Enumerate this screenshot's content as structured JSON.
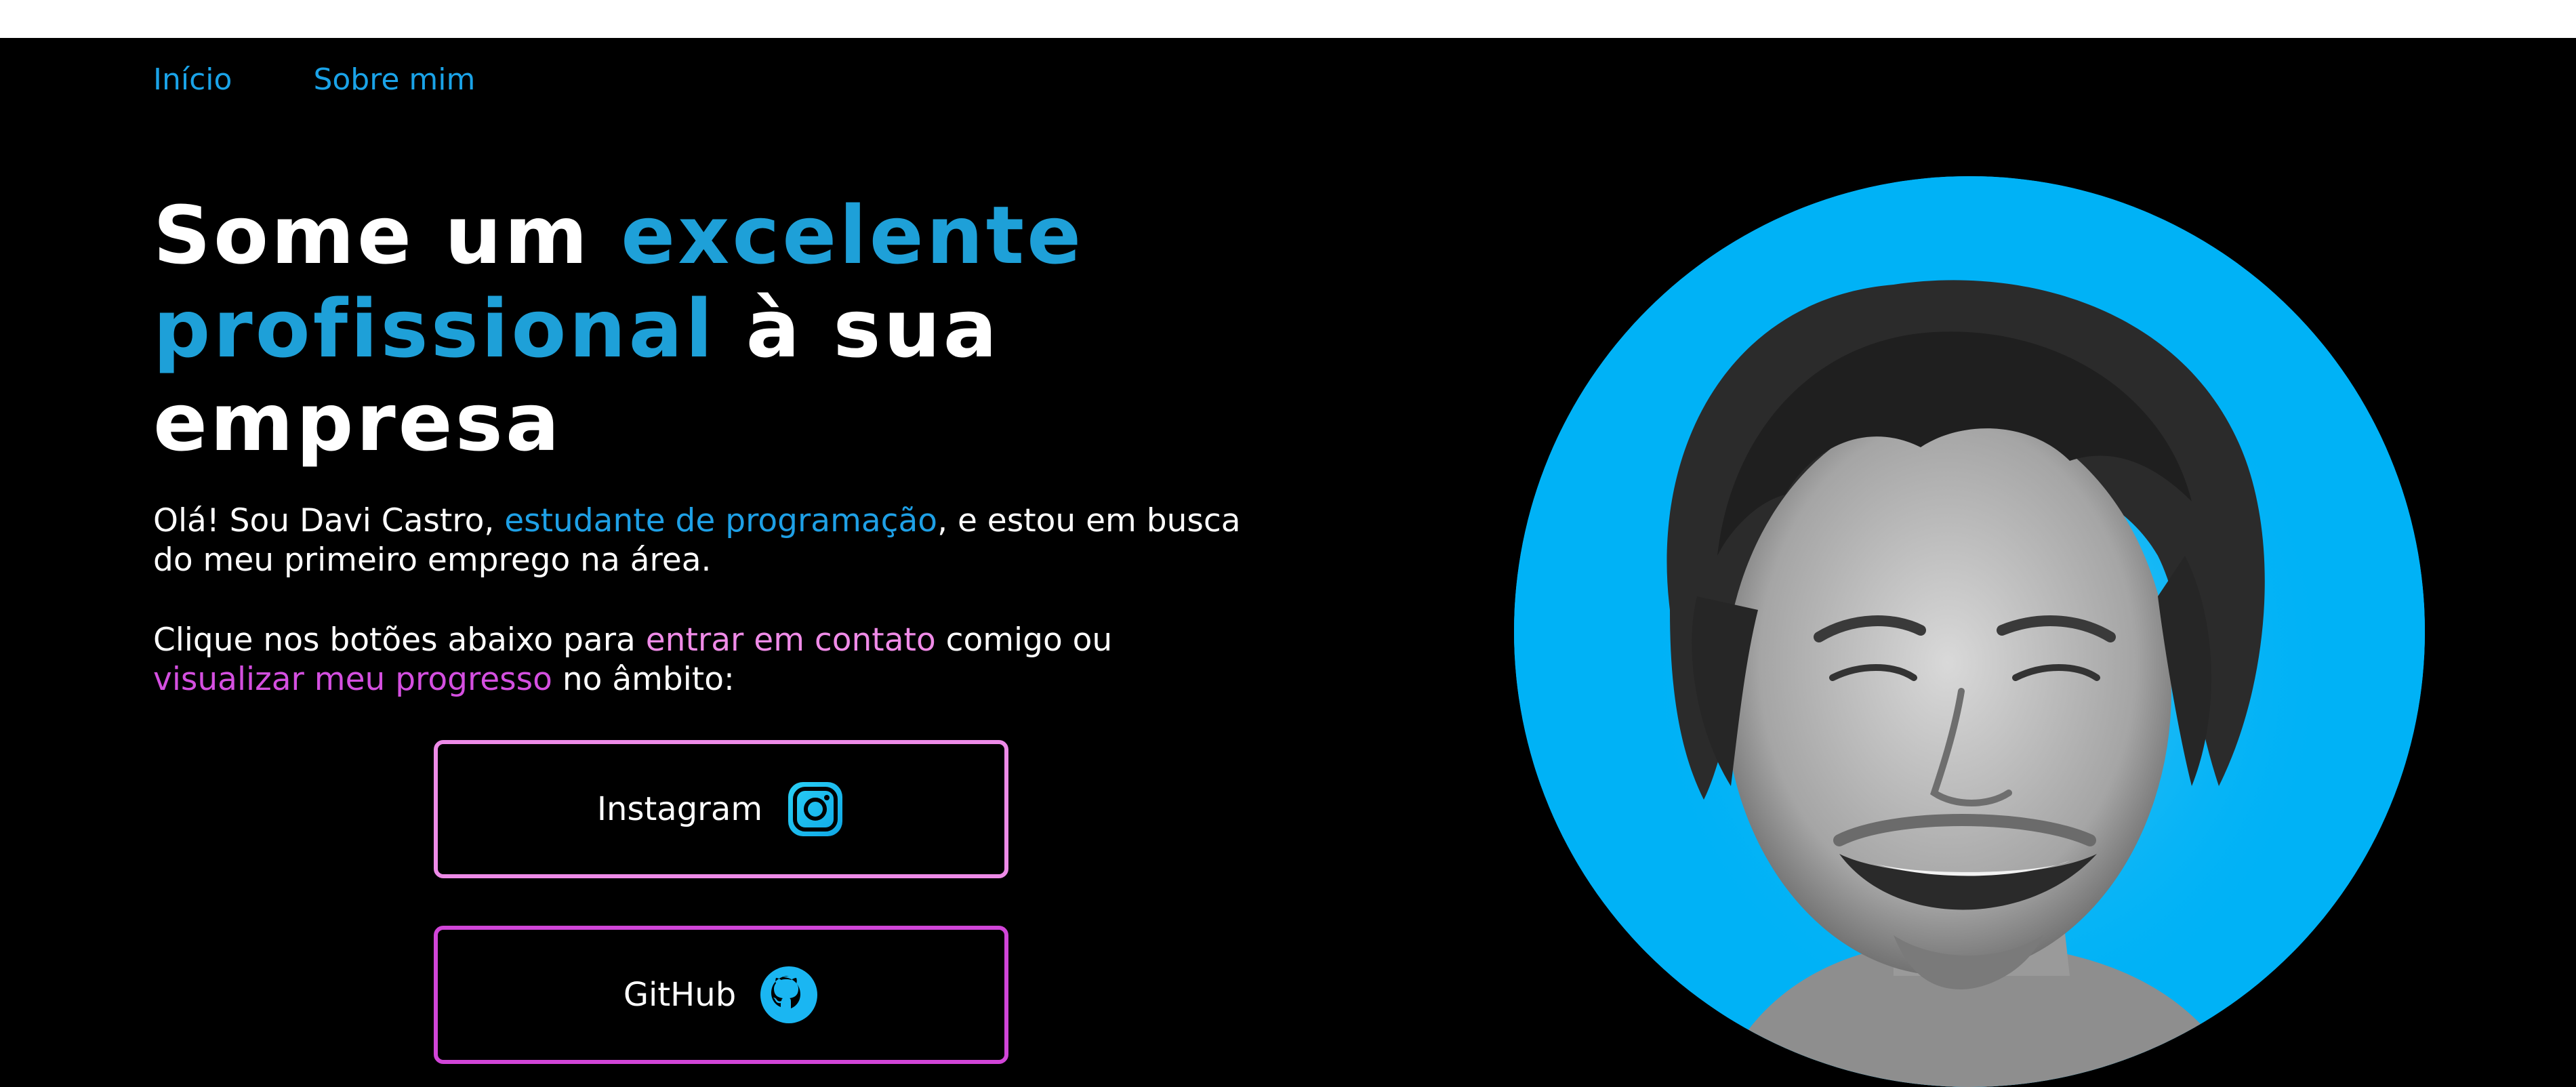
{
  "nav": {
    "items": [
      {
        "label": "Início"
      },
      {
        "label": "Sobre mim"
      }
    ]
  },
  "hero": {
    "headline": {
      "part1": "Some um ",
      "accent1": "excelente",
      "accent2": "profissional",
      "part2": " à sua",
      "part3": "empresa"
    },
    "intro": {
      "before": "Olá! Sou Davi Castro, ",
      "highlight": "estudante de programação",
      "after": ", e estou em busca",
      "line2": "do meu primeiro emprego na área."
    },
    "cta_text": {
      "before": "Clique nos botões abaixo para ",
      "highlight1": "entrar em contato",
      "middle": " comigo ou",
      "highlight2": "visualizar meu progresso",
      "after": " no âmbito:"
    }
  },
  "buttons": {
    "instagram": {
      "label": "Instagram",
      "icon": "instagram-icon"
    },
    "github": {
      "label": "GitHub",
      "icon": "github-icon"
    }
  },
  "avatar": {
    "description_icon": "profile-photo",
    "background_color": "#00b2f6"
  },
  "colors": {
    "accent_blue": "#1ea0d8",
    "accent_pink": "#f08be8",
    "accent_magenta": "#d44fe0",
    "background": "#000000"
  }
}
